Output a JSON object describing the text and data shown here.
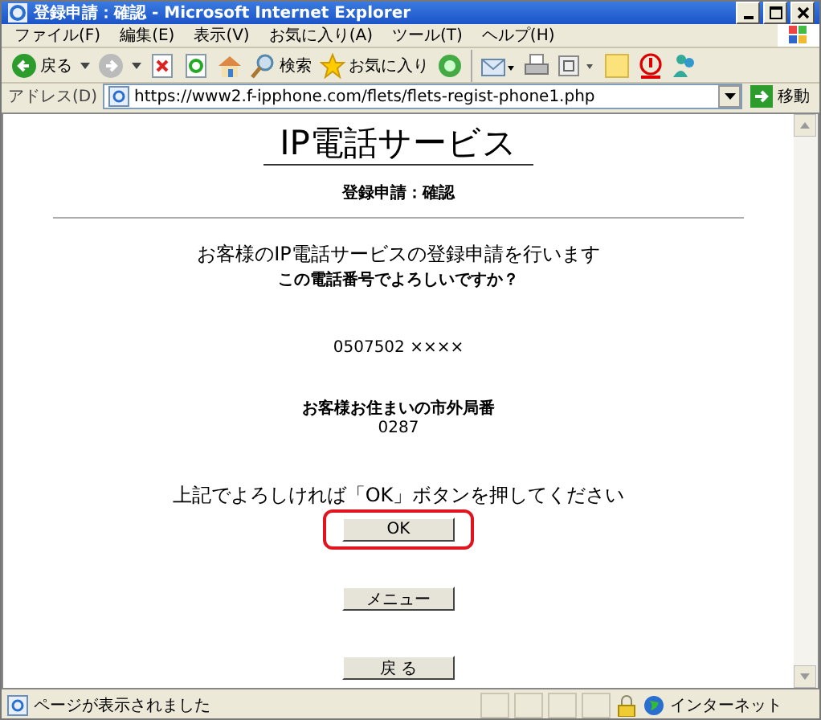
{
  "window": {
    "title": "登録申請：確認 - Microsoft Internet Explorer"
  },
  "menu": [
    "ファイル(F)",
    "編集(E)",
    "表示(V)",
    "お気に入り(A)",
    "ツール(T)",
    "ヘルプ(H)"
  ],
  "toolbar": {
    "back": "戻る",
    "search": "検索",
    "favorites": "お気に入り"
  },
  "address": {
    "label": "アドレス(D)",
    "url": "https://www2.f-ipphone.com/flets/flets-regist-phone1.php",
    "go": "移動"
  },
  "page": {
    "heading": "IP電話サービス",
    "subheading": "登録申請：確認",
    "intro": "お客様のIP電話サービスの登録申請を行います",
    "question": "この電話番号でよろしいですか？",
    "phone": "0507502 ××××",
    "area_label": "お客様お住まいの市外局番",
    "area_code": "0287",
    "instruction": "上記でよろしければ「OK」ボタンを押してください",
    "buttons": [
      {
        "label": "OK",
        "highlighted": true
      },
      {
        "label": "メニュー",
        "highlighted": false
      },
      {
        "label": "戻 る",
        "highlighted": false
      }
    ]
  },
  "status_bar": {
    "text": "ページが表示されました",
    "zone": "インターネット"
  }
}
